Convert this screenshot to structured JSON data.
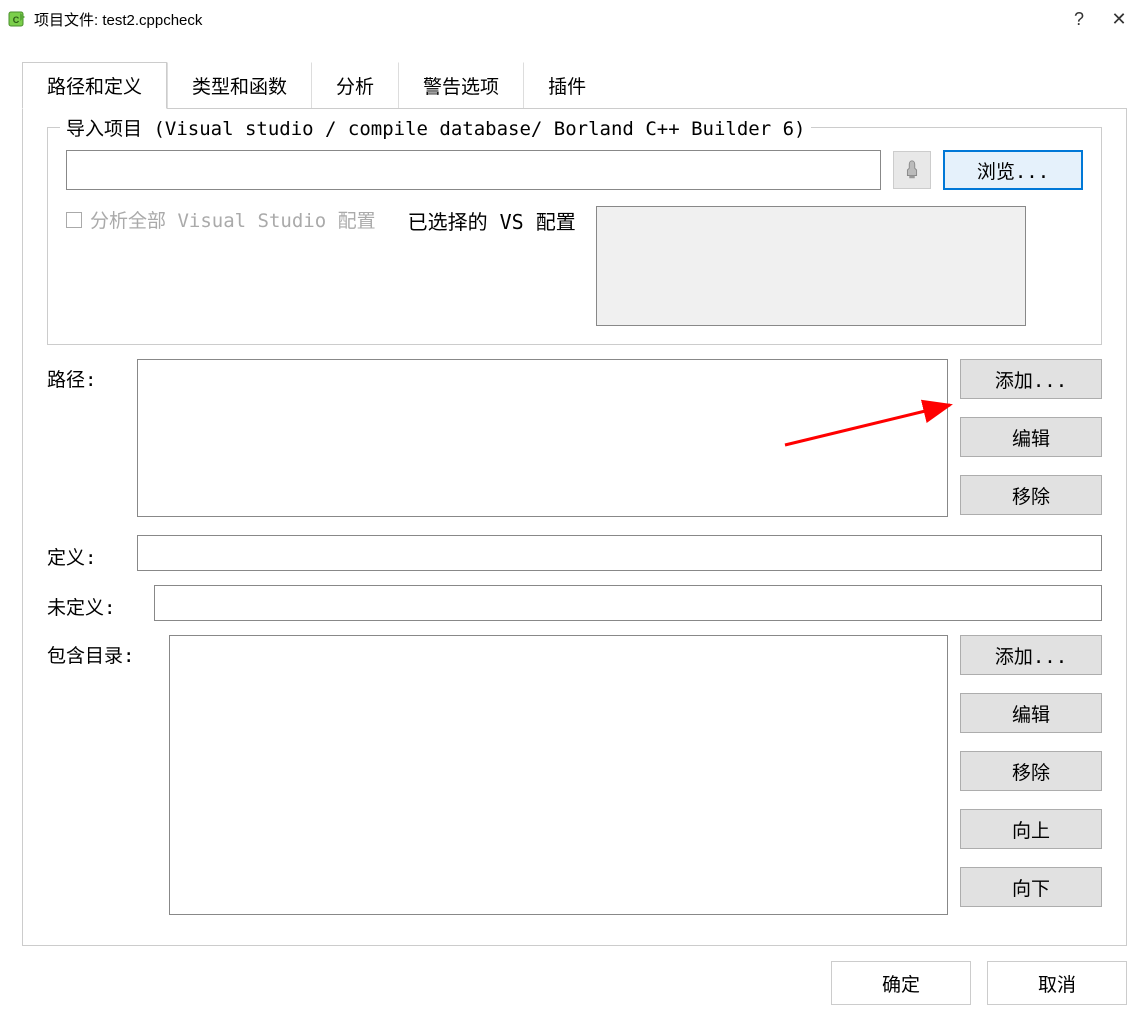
{
  "titlebar": {
    "title": "项目文件: test2.cppcheck",
    "help": "?",
    "close": "✕"
  },
  "tabs": {
    "t0": "路径和定义",
    "t1": "类型和函数",
    "t2": "分析",
    "t3": "警告选项",
    "t4": "插件"
  },
  "importGroup": {
    "title": "导入项目 (Visual studio / compile database/ Borland C++ Builder 6)",
    "path_value": "",
    "browse_btn": "浏览...",
    "analyze_all_vs": "分析全部 Visual Studio 配置",
    "selected_vs_label": "已选择的 VS 配置"
  },
  "paths": {
    "label": "路径:",
    "add_btn": "添加...",
    "edit_btn": "编辑",
    "remove_btn": "移除"
  },
  "defines": {
    "label": "定义:",
    "value": ""
  },
  "undefines": {
    "label": "未定义:",
    "value": ""
  },
  "includes": {
    "label": "包含目录:",
    "add_btn": "添加...",
    "edit_btn": "编辑",
    "remove_btn": "移除",
    "up_btn": "向上",
    "down_btn": "向下"
  },
  "footer": {
    "ok": "确定",
    "cancel": "取消"
  }
}
